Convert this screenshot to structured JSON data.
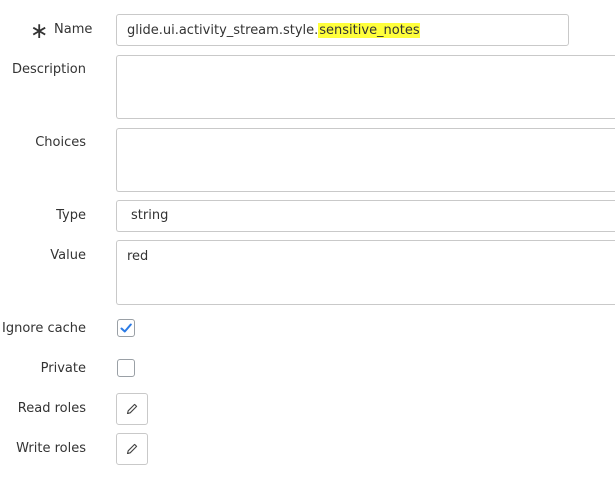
{
  "form": {
    "name": {
      "label": "Name",
      "required": true,
      "value_plain": "glide.ui.activity_stream.style.",
      "value_highlighted": "sensitive_notes"
    },
    "description": {
      "label": "Description",
      "value": ""
    },
    "choices": {
      "label": "Choices",
      "value": ""
    },
    "type": {
      "label": "Type",
      "value": "string"
    },
    "value": {
      "label": "Value",
      "value": "red"
    },
    "ignore_cache": {
      "label": "Ignore cache",
      "checked": true
    },
    "private": {
      "label": "Private",
      "checked": false
    },
    "read_roles": {
      "label": "Read roles",
      "icon": "pencil-icon"
    },
    "write_roles": {
      "label": "Write roles",
      "icon": "pencil-icon"
    }
  },
  "colors": {
    "highlight": "#ffff3c",
    "check": "#2c7be5",
    "border": "#c9c9c9"
  }
}
